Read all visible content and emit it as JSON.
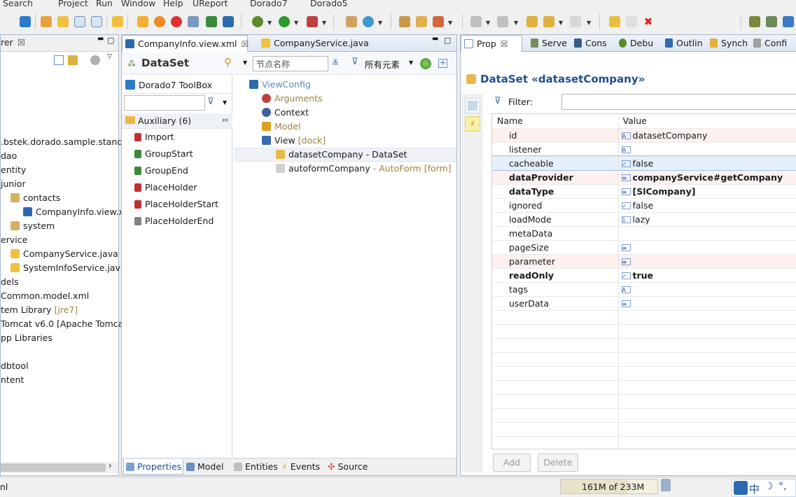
{
  "menu": [
    "Search",
    "Project",
    "Run",
    "Window",
    "Help",
    "UReport",
    "Dorado7",
    "Dorado5"
  ],
  "explorer": {
    "tab_label": "rer",
    "tree": [
      {
        "text": ".bstek.dorado.sample.standa",
        "indent": 0
      },
      {
        "text": "dao",
        "indent": 0
      },
      {
        "text": "entity",
        "indent": 0
      },
      {
        "text": "junior",
        "indent": 0
      },
      {
        "text": "contacts",
        "indent": 14
      },
      {
        "text": "CompanyInfo.view.xml",
        "indent": 32
      },
      {
        "text": "system",
        "indent": 14
      },
      {
        "text": "ervice",
        "indent": 0
      },
      {
        "text": "CompanyService.java",
        "indent": 14
      },
      {
        "text": "SystemInfoService.java",
        "indent": 14
      },
      {
        "text": "dels",
        "indent": 0
      },
      {
        "text": "Common.model.xml",
        "indent": 0
      },
      {
        "text": "tem Library ",
        "suffix": "[jre7]",
        "indent": 0
      },
      {
        "text": " Tomcat v6.0 [Apache Tomca",
        "indent": 0
      },
      {
        "text": "pp Libraries",
        "indent": 0
      },
      {
        "text": "",
        "indent": 0
      },
      {
        "text": "dbtool",
        "indent": 0
      },
      {
        "text": "ntent",
        "indent": 0
      }
    ]
  },
  "editor": {
    "tabs": [
      {
        "label": "CompanyInfo.view.xml",
        "active": true
      },
      {
        "label": "CompanyService.java",
        "active": false
      }
    ],
    "header_title": "DataSet",
    "search_placeholder": "节点名称",
    "filter_label": "所有元素",
    "toolbox": {
      "title": "Dorado7 ToolBox",
      "category": "Auxiliary (6)",
      "items": [
        "Import",
        "GroupStart",
        "GroupEnd",
        "PlaceHolder",
        "PlaceHolderStart",
        "PlaceHolderEnd"
      ]
    },
    "outline": [
      {
        "text": "ViewConfig",
        "style": "link",
        "indent": 0
      },
      {
        "text": "Arguments",
        "style": "grey",
        "indent": 18
      },
      {
        "text": "Context",
        "style": "normal",
        "indent": 18
      },
      {
        "text": "Model",
        "style": "grey",
        "indent": 18
      },
      {
        "text": "View ",
        "suffix": "[dock]",
        "style": "normal",
        "indent": 18
      },
      {
        "text": "datasetCompany - DataSet",
        "style": "normal",
        "indent": 38,
        "selected": true
      },
      {
        "text": "autoformCompany",
        "suffix": " - AutoForm [form]",
        "style": "normal",
        "indent": 38
      }
    ],
    "bottom_tabs": [
      "Properties",
      "Model",
      "Entities",
      "Events",
      "Source"
    ]
  },
  "properties": {
    "tabs": [
      "Prop",
      "Serve",
      "Cons",
      "Debu",
      "Outlin",
      "Synch",
      "Confi"
    ],
    "title": "DataSet «datasetCompany»",
    "filter_label": "Filter:",
    "columns": [
      "Name",
      "Value"
    ],
    "rows": [
      {
        "name": "id",
        "value": "datasetCompany",
        "icon": "A",
        "bold": false,
        "tint": "pink"
      },
      {
        "name": "listener",
        "value": "",
        "icon": "A",
        "bold": false,
        "tint": ""
      },
      {
        "name": "cacheable",
        "value": "false",
        "icon": "✓",
        "bold": false,
        "tint": "blue"
      },
      {
        "name": "dataProvider",
        "value": "companyService#getCompany",
        "icon": "≡",
        "bold": true,
        "tint": "pink"
      },
      {
        "name": "dataType",
        "value": "[SlCompany]",
        "icon": "≡",
        "bold": true,
        "tint": ""
      },
      {
        "name": "ignored",
        "value": "false",
        "icon": "✓",
        "bold": false,
        "tint": ""
      },
      {
        "name": "loadMode",
        "value": "lazy",
        "icon": "1",
        "bold": false,
        "tint": ""
      },
      {
        "name": "metaData",
        "value": "",
        "icon": "",
        "bold": false,
        "tint": ""
      },
      {
        "name": "pageSize",
        "value": "",
        "icon": "≡",
        "bold": false,
        "tint": ""
      },
      {
        "name": "parameter",
        "value": "",
        "icon": "≡",
        "bold": false,
        "tint": "pink"
      },
      {
        "name": "readOnly",
        "value": "true",
        "icon": "✓",
        "bold": true,
        "tint": ""
      },
      {
        "name": "tags",
        "value": "",
        "icon": "A",
        "bold": false,
        "tint": ""
      },
      {
        "name": "userData",
        "value": "",
        "icon": "≡",
        "bold": false,
        "tint": ""
      }
    ],
    "add_button": "Add",
    "delete_button": "Delete"
  },
  "status": {
    "left": "nl",
    "memory": "161M of 233M",
    "ime": "中"
  },
  "colors": {
    "accent": "#1f4e96",
    "tab_bg": "#dde6f2",
    "selected_row": "#e6f0fb",
    "pink_row": "#fdf1f0"
  }
}
